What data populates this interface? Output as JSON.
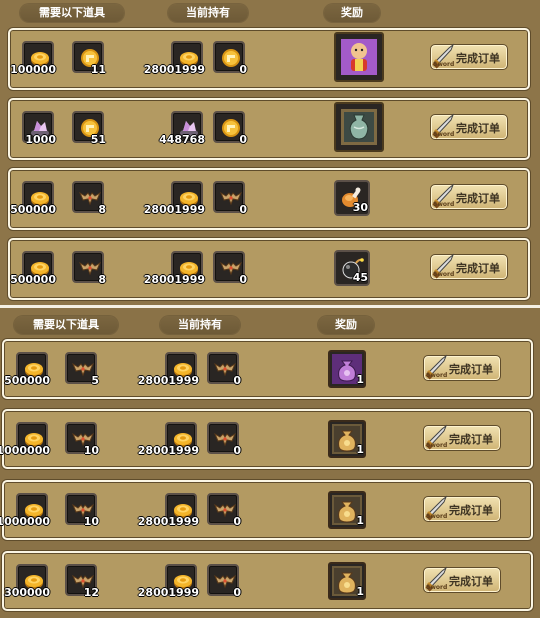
{
  "sections": [
    {
      "headers": {
        "required": "需要以下道具",
        "owned": "当前持有",
        "reward": "奖励"
      },
      "orders": [
        {
          "req": [
            {
              "icon": "gold-coin-icon",
              "count": "100000"
            },
            {
              "icon": "medal-coin-icon",
              "count": "11"
            }
          ],
          "own": [
            {
              "icon": "gold-coin-icon",
              "count": "28001999"
            },
            {
              "icon": "medal-coin-icon",
              "count": "0"
            }
          ],
          "reward": {
            "icon": "monk-character-icon",
            "count": ""
          },
          "button": "完成订单",
          "button_sub": "Sword"
        },
        {
          "req": [
            {
              "icon": "crystal-ore-icon",
              "count": "1000"
            },
            {
              "icon": "medal-coin-icon",
              "count": "51"
            }
          ],
          "own": [
            {
              "icon": "crystal-ore-icon",
              "count": "448768"
            },
            {
              "icon": "medal-coin-icon",
              "count": "0"
            }
          ],
          "reward": {
            "icon": "jade-vase-icon",
            "count": ""
          },
          "button": "完成订单",
          "button_sub": "Sword"
        },
        {
          "req": [
            {
              "icon": "gold-coin-icon",
              "count": "500000"
            },
            {
              "icon": "bat-emblem-icon",
              "count": "8"
            }
          ],
          "own": [
            {
              "icon": "gold-coin-icon",
              "count": "28001999"
            },
            {
              "icon": "bat-emblem-icon",
              "count": "0"
            }
          ],
          "reward": {
            "icon": "meat-drumstick-icon",
            "count": "30"
          },
          "button": "完成订单",
          "button_sub": "Sword"
        },
        {
          "req": [
            {
              "icon": "gold-coin-icon",
              "count": "500000"
            },
            {
              "icon": "bat-emblem-icon",
              "count": "8"
            }
          ],
          "own": [
            {
              "icon": "gold-coin-icon",
              "count": "28001999"
            },
            {
              "icon": "bat-emblem-icon",
              "count": "0"
            }
          ],
          "reward": {
            "icon": "bomb-icon",
            "count": "45"
          },
          "button": "完成订单",
          "button_sub": "Sword"
        }
      ]
    },
    {
      "headers": {
        "required": "需要以下道具",
        "owned": "当前持有",
        "reward": "奖励"
      },
      "orders": [
        {
          "req": [
            {
              "icon": "gold-coin-icon",
              "count": "500000"
            },
            {
              "icon": "bat-emblem-icon",
              "count": "5"
            }
          ],
          "own": [
            {
              "icon": "gold-coin-icon",
              "count": "28001999"
            },
            {
              "icon": "bat-emblem-icon",
              "count": "0"
            }
          ],
          "reward": {
            "icon": "purple-bag-icon",
            "count": "1"
          },
          "button": "完成订单",
          "button_sub": "Sword"
        },
        {
          "req": [
            {
              "icon": "gold-coin-icon",
              "count": "1000000"
            },
            {
              "icon": "bat-emblem-icon",
              "count": "10"
            }
          ],
          "own": [
            {
              "icon": "gold-coin-icon",
              "count": "28001999"
            },
            {
              "icon": "bat-emblem-icon",
              "count": "0"
            }
          ],
          "reward": {
            "icon": "gold-bag-icon",
            "count": "1"
          },
          "button": "完成订单",
          "button_sub": "Sword"
        },
        {
          "req": [
            {
              "icon": "gold-coin-icon",
              "count": "1000000"
            },
            {
              "icon": "bat-emblem-icon",
              "count": "10"
            }
          ],
          "own": [
            {
              "icon": "gold-coin-icon",
              "count": "28001999"
            },
            {
              "icon": "bat-emblem-icon",
              "count": "0"
            }
          ],
          "reward": {
            "icon": "gold-bag-icon",
            "count": "1"
          },
          "button": "完成订单",
          "button_sub": "Sword"
        },
        {
          "req": [
            {
              "icon": "gold-coin-icon",
              "count": "300000"
            },
            {
              "icon": "bat-emblem-icon",
              "count": "12"
            }
          ],
          "own": [
            {
              "icon": "gold-coin-icon",
              "count": "28001999"
            },
            {
              "icon": "bat-emblem-icon",
              "count": "0"
            }
          ],
          "reward": {
            "icon": "gold-bag-icon",
            "count": "1"
          },
          "button": "完成订单",
          "button_sub": "Sword"
        }
      ]
    }
  ]
}
